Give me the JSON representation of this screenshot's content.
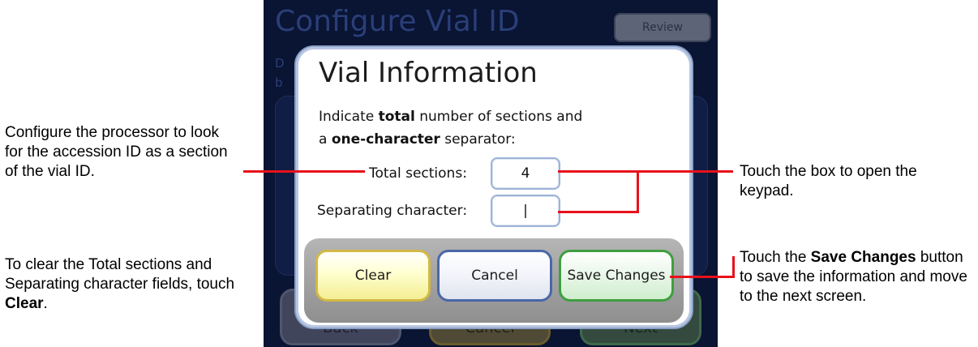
{
  "background": {
    "title": "Configure Vial ID",
    "review_label": "Review",
    "desc_line1": "D",
    "desc_line2": "b",
    "back_label": "Back",
    "cancel_label": "Cancel",
    "next_label": "Next"
  },
  "dialog": {
    "title": "Vial Information",
    "text_line1_a": "Indicate ",
    "text_line1_b": "total",
    "text_line1_c": " number of sections and",
    "text_line2_a": "a ",
    "text_line2_b": "one-character",
    "text_line2_c": " separator:",
    "total_sections_label": "Total sections:",
    "total_sections_value": "4",
    "separator_label": "Separating character:",
    "separator_value": "|",
    "clear_label": "Clear",
    "cancel_label": "Cancel",
    "save_label": "Save Changes"
  },
  "callouts": {
    "left_top": "Configure the processor to look for the accession ID as a section of the vial ID.",
    "left_bottom_a": "To clear the Total sections and Separating character fields, touch ",
    "left_bottom_b": "Clear",
    "left_bottom_c": ".",
    "right_top": "Touch the box to open the keypad.",
    "right_bottom_a": "Touch the ",
    "right_bottom_b": "Save Changes",
    "right_bottom_c": " button to save the information and move to the next screen."
  },
  "colors": {
    "callout_line": "#e8111b",
    "screen_bg": "#0a1433",
    "clear_border": "#d2b845",
    "cancel_border": "#4a67a8",
    "save_border": "#3f9f40"
  }
}
